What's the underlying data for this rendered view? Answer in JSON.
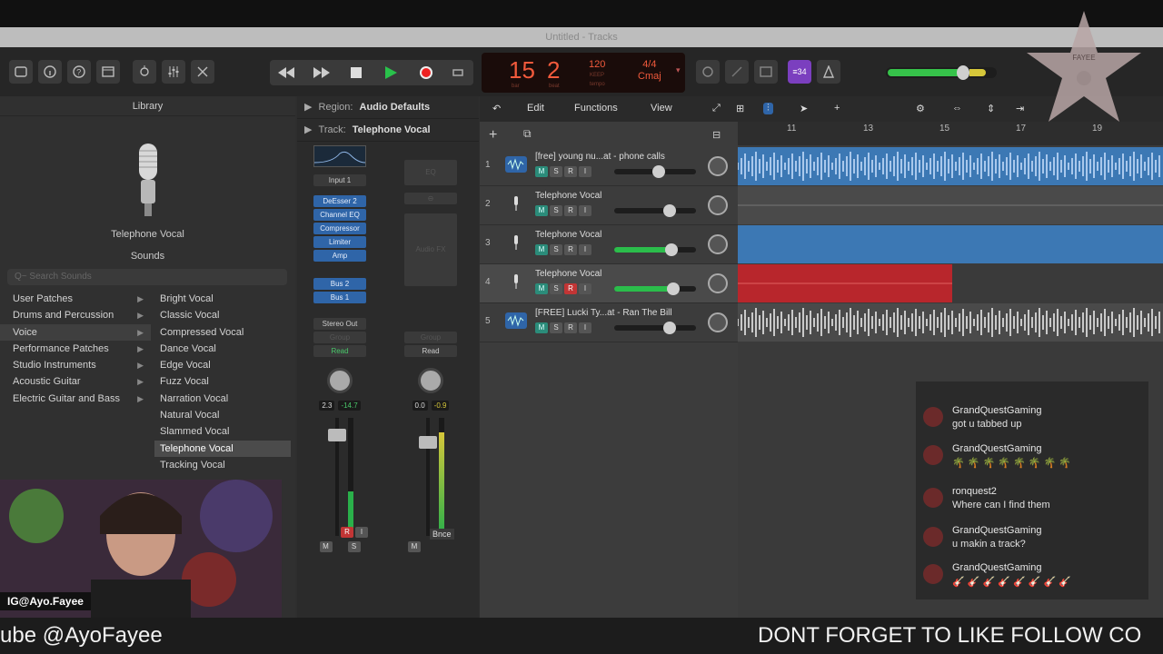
{
  "window": {
    "title": "Untitled - Tracks"
  },
  "lcd": {
    "bar": "15",
    "beat": "2",
    "bar_sub": "bar",
    "beat_sub": "beat",
    "tempo": "120",
    "tempo_sub": "KEEP",
    "tempo_sub2": "tempo",
    "signature": "4/4",
    "key": "Cmaj"
  },
  "library": {
    "title": "Library",
    "patch_name": "Telephone Vocal",
    "sounds_label": "Sounds",
    "search_placeholder": "Q~ Search Sounds",
    "categories": [
      {
        "label": "User Patches",
        "selected": false
      },
      {
        "label": "Drums and Percussion",
        "selected": false
      },
      {
        "label": "Voice",
        "selected": true
      },
      {
        "label": "Performance Patches",
        "selected": false
      },
      {
        "label": "Studio Instruments",
        "selected": false
      },
      {
        "label": "Acoustic Guitar",
        "selected": false
      },
      {
        "label": "Electric Guitar and Bass",
        "selected": false
      }
    ],
    "patches": [
      {
        "label": "Bright Vocal",
        "selected": false
      },
      {
        "label": "Classic Vocal",
        "selected": false
      },
      {
        "label": "Compressed Vocal",
        "selected": false
      },
      {
        "label": "Dance Vocal",
        "selected": false
      },
      {
        "label": "Edge Vocal",
        "selected": false
      },
      {
        "label": "Fuzz Vocal",
        "selected": false
      },
      {
        "label": "Narration Vocal",
        "selected": false
      },
      {
        "label": "Natural Vocal",
        "selected": false
      },
      {
        "label": "Slammed Vocal",
        "selected": false
      },
      {
        "label": "Telephone Vocal",
        "selected": true
      },
      {
        "label": "Tracking Vocal",
        "selected": false
      }
    ]
  },
  "inspector": {
    "region_label": "Region:",
    "region_value": "Audio Defaults",
    "track_label": "Track:",
    "track_value": "Telephone Vocal",
    "strip1": {
      "input": "Input 1",
      "plugins": [
        "DeEsser 2",
        "Channel EQ",
        "Compressor",
        "Limiter",
        "Amp"
      ],
      "sends": [
        "Bus 2",
        "Bus 1"
      ],
      "output": "Stereo Out",
      "group": "Group",
      "automation": "Read",
      "vol": "2.3",
      "peak": "-14.7",
      "mute": "M",
      "solo": "S",
      "rec": "R",
      "input_mon": "I"
    },
    "strip2": {
      "eq": "EQ",
      "plugins": [
        "Audio FX"
      ],
      "group": "Group",
      "automation": "Read",
      "vol": "0.0",
      "peak": "-0.9",
      "name": "Bnce",
      "mute": "M"
    }
  },
  "tracks_toolbar": {
    "edit": "Edit",
    "functions": "Functions",
    "view": "View"
  },
  "ruler": {
    "marks": [
      "11",
      "13",
      "15",
      "17",
      "19"
    ]
  },
  "tracks": [
    {
      "num": "1",
      "name": "[free] young nu...at - phone calls",
      "type": "audio",
      "rec": false,
      "level": 0.6
    },
    {
      "num": "2",
      "name": "Telephone Vocal",
      "type": "mic",
      "rec": false,
      "level": 0.75
    },
    {
      "num": "3",
      "name": "Telephone Vocal",
      "type": "mic",
      "rec": false,
      "level": 0.78
    },
    {
      "num": "4",
      "name": "Telephone Vocal",
      "type": "mic",
      "rec": true,
      "level": 0.8
    },
    {
      "num": "5",
      "name": "[FREE] Lucki Ty...at - Ran The Bill",
      "type": "audio",
      "rec": false,
      "level": 0.75
    }
  ],
  "track_buttons": {
    "mute": "M",
    "solo": "S",
    "rec": "R",
    "input": "I"
  },
  "chat": {
    "messages": [
      {
        "user": "GrandQuestGaming",
        "text": "got u tabbed up"
      },
      {
        "user": "GrandQuestGaming",
        "text": "🌴 🌴 🌴 🌴 🌴 🌴 🌴 🌴"
      },
      {
        "user": "ronquest2",
        "text": "Where can I find them"
      },
      {
        "user": "GrandQuestGaming",
        "text": "u makin a track?"
      },
      {
        "user": "GrandQuestGaming",
        "text": "🎸 🎸 🎸 🎸 🎸 🎸 🎸 🎸"
      }
    ]
  },
  "overlay": {
    "ig_handle": "IG@Ayo.Fayee",
    "ticker_left": "ube @AyoFayee",
    "ticker_right": "DONT FORGET TO LIKE FOLLOW CO",
    "star_text": "FAYEE"
  },
  "colors": {
    "accent_green": "#2bbd4b",
    "record_red": "#c23535",
    "region_blue": "#3c78b4",
    "region_red": "#b8262c",
    "lcd_text": "#f15a3c"
  }
}
